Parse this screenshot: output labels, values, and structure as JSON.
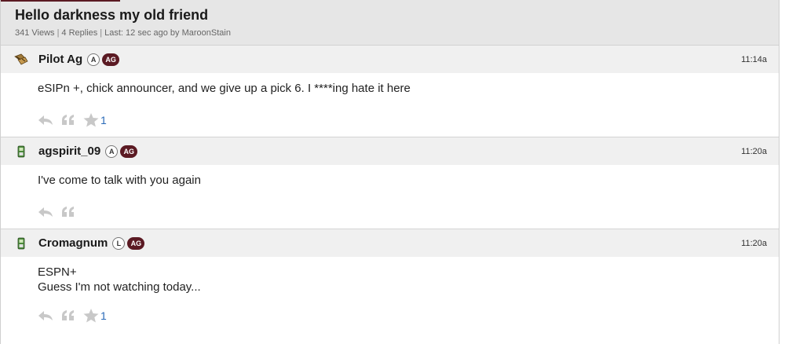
{
  "thread": {
    "title": "Hello darkness my old friend",
    "views": "341 Views",
    "replies": "4 Replies",
    "last": "Last: 12 sec ago by MaroonStain"
  },
  "posts": [
    {
      "username": "Pilot Ag",
      "status_badge": "A",
      "group_badge": "AG",
      "time": "11:14a",
      "avatar_icon": "sandals-icon",
      "lines": [
        "eSIPn +, chick announcer, and we give up a pick 6. I ****ing hate it here"
      ],
      "star_count": "1"
    },
    {
      "username": "agspirit_09",
      "status_badge": "A",
      "group_badge": "AG",
      "time": "11:20a",
      "avatar_icon": "cellphone-icon",
      "lines": [
        "I've come to talk with you again"
      ],
      "star_count": ""
    },
    {
      "username": "Cromagnum",
      "status_badge": "L",
      "group_badge": "AG",
      "time": "11:20a",
      "avatar_icon": "cellphone-icon",
      "lines": [
        "ESPN+",
        "Guess I'm not watching today..."
      ],
      "star_count": "1"
    }
  ],
  "colors": {
    "maroon": "#5b1a23",
    "header_bg": "#e6e6e6",
    "post_head_bg": "#f0f0f0",
    "link_blue": "#2a6ab8",
    "icon_gray": "#c8c8c8"
  }
}
